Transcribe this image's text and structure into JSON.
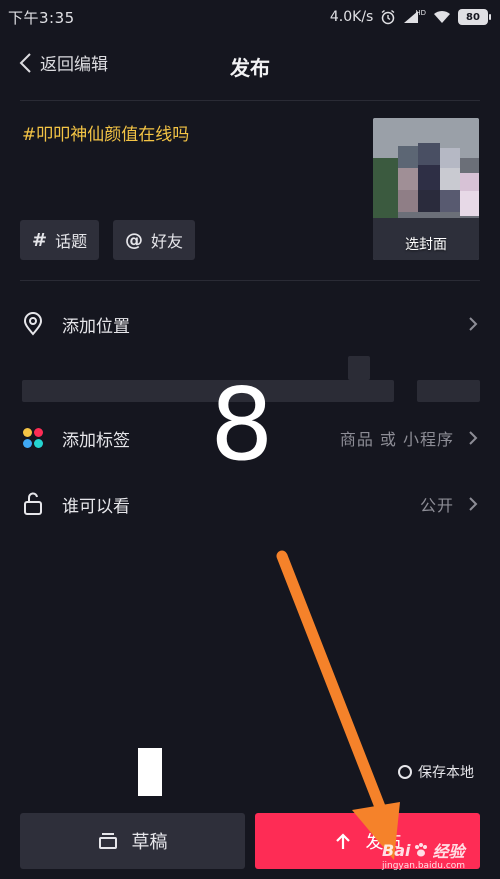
{
  "status_bar": {
    "time": "下午3:35",
    "net_speed": "4.0K/s",
    "hd": "HD",
    "battery": "80"
  },
  "nav": {
    "back_label": "返回编辑",
    "title": "发布"
  },
  "post": {
    "caption": "#叩叩神仙颜值在线吗",
    "cover_label": "选封面",
    "chips": [
      {
        "symbol": "#",
        "label": "话题"
      },
      {
        "symbol": "@",
        "label": "好友"
      }
    ]
  },
  "options": {
    "location": {
      "label": "添加位置"
    },
    "tag": {
      "label": "添加标签",
      "value": "商品 或 小程序"
    },
    "visibility": {
      "label": "谁可以看",
      "value": "公开"
    }
  },
  "overlay": {
    "step_number": "8"
  },
  "footer": {
    "save_local": "保存本地",
    "draft": "草稿",
    "publish": "发布"
  },
  "watermark": {
    "brand": "Bai",
    "brand_suffix": "经验",
    "url": "jingyan.baidu.com"
  },
  "colors": {
    "background": "#15161f",
    "publish_button": "#fe2c55",
    "caption": "#f4c445",
    "arrow": "#f5822a"
  }
}
